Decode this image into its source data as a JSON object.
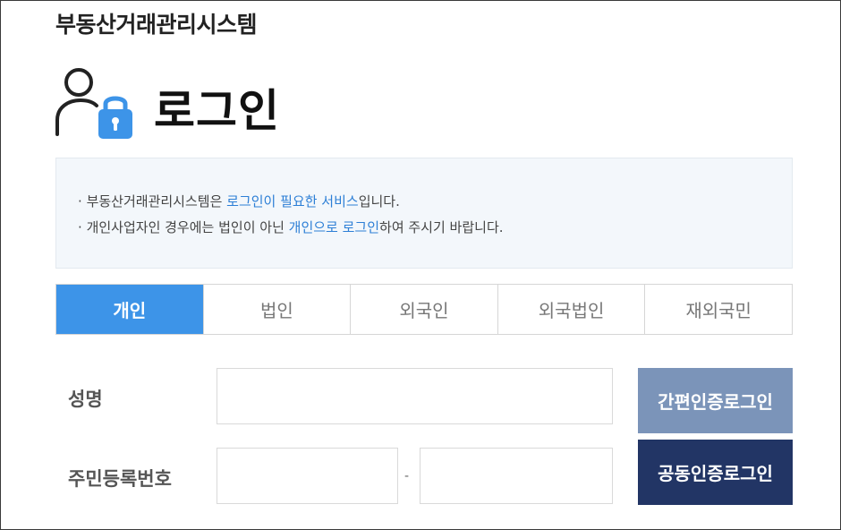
{
  "header": {
    "system_title": "부동산거래관리시스템"
  },
  "login": {
    "title": "로그인",
    "icon": "user-lock-icon",
    "icon_color": "#3d94e8"
  },
  "notice": {
    "lines": [
      {
        "bullet": "·",
        "before": "부동산거래관리시스템은 ",
        "highlight": "로그인이 필요한 서비스",
        "after": "입니다."
      },
      {
        "bullet": "·",
        "before": "개인사업자인 경우에는 법인이 아닌 ",
        "highlight": "개인으로 로그인",
        "after": "하여 주시기 바랍니다."
      }
    ],
    "highlight_color": "#2d7fd6"
  },
  "tabs": [
    {
      "label": "개인",
      "active": true
    },
    {
      "label": "법인",
      "active": false
    },
    {
      "label": "외국인",
      "active": false
    },
    {
      "label": "외국법인",
      "active": false
    },
    {
      "label": "재외국민",
      "active": false
    }
  ],
  "form": {
    "name_label": "성명",
    "name_value": "",
    "rrn_label": "주민등록번호",
    "rrn_front_value": "",
    "rrn_back_value": "",
    "rrn_separator": "-"
  },
  "buttons": {
    "simple_auth_login": "간편인증로그인",
    "cert_login": "공동인증로그인"
  },
  "colors": {
    "active_tab": "#3d94e8",
    "simple_auth_button": "#7b94b9",
    "cert_button": "#223565"
  }
}
